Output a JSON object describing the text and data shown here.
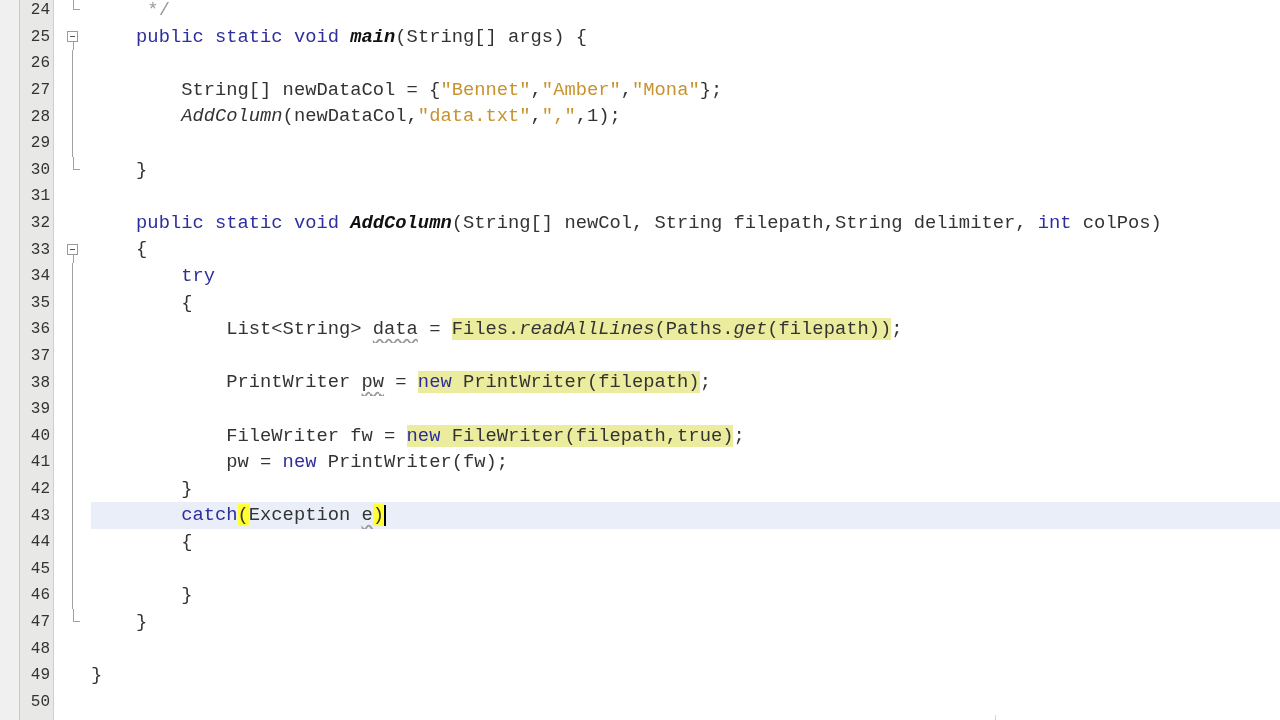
{
  "editor": {
    "lines": [
      {
        "number": "24",
        "kind": "end",
        "current": false,
        "tokens": [
          {
            "kind": "comment",
            "text": "     */"
          }
        ]
      },
      {
        "number": "25",
        "kind": "start",
        "current": false,
        "tokens": [
          {
            "kind": "keyword",
            "text": "    public static void "
          },
          {
            "kind": "method",
            "text": "main"
          },
          {
            "kind": "plain",
            "text": "(String[] args) {"
          }
        ]
      },
      {
        "number": "26",
        "kind": "mid",
        "current": false
      },
      {
        "number": "27",
        "kind": "mid",
        "current": false,
        "tokens": [
          {
            "kind": "plain",
            "text": "        String[] newDataCol = {"
          },
          {
            "kind": "string",
            "text": "\"Bennet\""
          },
          {
            "kind": "plain",
            "text": ","
          },
          {
            "kind": "string",
            "text": "\"Amber\""
          },
          {
            "kind": "plain",
            "text": ","
          },
          {
            "kind": "string",
            "text": "\"Mona\""
          },
          {
            "kind": "plain",
            "text": "};"
          }
        ]
      },
      {
        "number": "28",
        "kind": "mid",
        "current": false,
        "tokens": [
          {
            "kind": "call",
            "text": "        AddColumn"
          },
          {
            "kind": "plain",
            "text": "(newDataCol,"
          },
          {
            "kind": "string",
            "text": "\"data.txt\""
          },
          {
            "kind": "plain",
            "text": ","
          },
          {
            "kind": "string",
            "text": "\",\""
          },
          {
            "kind": "plain",
            "text": ",1);"
          }
        ]
      },
      {
        "number": "29",
        "kind": "mid",
        "current": false
      },
      {
        "number": "30",
        "kind": "end",
        "current": false,
        "tokens": [
          {
            "kind": "plain",
            "text": "    }"
          }
        ]
      },
      {
        "number": "31",
        "kind": "none",
        "current": false
      },
      {
        "number": "32",
        "kind": "none",
        "current": false,
        "tokens": [
          {
            "kind": "keyword",
            "text": "    public static void "
          },
          {
            "kind": "method",
            "text": "AddColumn"
          },
          {
            "kind": "plain",
            "text": "(String[] newCol, String filepath,String delimiter, "
          },
          {
            "kind": "keyword",
            "text": "int"
          },
          {
            "kind": "plain",
            "text": " colPos)"
          }
        ]
      },
      {
        "number": "33",
        "kind": "start",
        "current": false,
        "tokens": [
          {
            "kind": "plain",
            "text": "    {"
          }
        ]
      },
      {
        "number": "34",
        "kind": "mid",
        "current": false,
        "tokens": [
          {
            "kind": "keyword",
            "text": "        try"
          }
        ]
      },
      {
        "number": "35",
        "kind": "mid",
        "current": false,
        "tokens": [
          {
            "kind": "plain",
            "text": "        {"
          }
        ]
      },
      {
        "number": "36",
        "kind": "mid",
        "current": false,
        "tokens": [
          {
            "kind": "plain",
            "text": "            List<String> "
          },
          {
            "kind": "warning",
            "text": "data"
          },
          {
            "kind": "plain",
            "text": " = "
          },
          {
            "kind": "marked",
            "text": "Files."
          },
          {
            "kind": "call-marked",
            "text": "readAllLines"
          },
          {
            "kind": "marked",
            "text": "(Paths."
          },
          {
            "kind": "call-marked",
            "text": "get"
          },
          {
            "kind": "marked",
            "text": "(filepath))"
          },
          {
            "kind": "plain",
            "text": ";"
          }
        ]
      },
      {
        "number": "37",
        "kind": "mid",
        "current": false
      },
      {
        "number": "38",
        "kind": "mid",
        "current": false,
        "tokens": [
          {
            "kind": "plain",
            "text": "            PrintWriter "
          },
          {
            "kind": "warning",
            "text": "pw"
          },
          {
            "kind": "plain",
            "text": " = "
          },
          {
            "kind": "keyword-marked",
            "text": "new"
          },
          {
            "kind": "marked",
            "text": " PrintWriter(filepath)"
          },
          {
            "kind": "plain",
            "text": ";"
          }
        ]
      },
      {
        "number": "39",
        "kind": "mid",
        "current": false
      },
      {
        "number": "40",
        "kind": "mid",
        "current": false,
        "tokens": [
          {
            "kind": "plain",
            "text": "            FileWriter fw = "
          },
          {
            "kind": "keyword-marked",
            "text": "new"
          },
          {
            "kind": "marked",
            "text": " FileWriter(filepath,true)"
          },
          {
            "kind": "plain",
            "text": ";"
          }
        ]
      },
      {
        "number": "41",
        "kind": "mid",
        "current": false,
        "tokens": [
          {
            "kind": "plain",
            "text": "            pw = "
          },
          {
            "kind": "keyword",
            "text": "new"
          },
          {
            "kind": "plain",
            "text": " PrintWriter(fw);"
          }
        ]
      },
      {
        "number": "42",
        "kind": "mid",
        "current": false,
        "tokens": [
          {
            "kind": "plain",
            "text": "        }"
          }
        ]
      },
      {
        "number": "43",
        "kind": "mid",
        "current": true,
        "tokens": [
          {
            "kind": "keyword",
            "text": "        catch"
          },
          {
            "kind": "bracket",
            "text": "("
          },
          {
            "kind": "plain",
            "text": "Exception "
          },
          {
            "kind": "warning",
            "text": "e"
          },
          {
            "kind": "bracket",
            "text": ")"
          }
        ]
      },
      {
        "number": "44",
        "kind": "mid",
        "current": false,
        "tokens": [
          {
            "kind": "plain",
            "text": "        {"
          }
        ]
      },
      {
        "number": "45",
        "kind": "mid",
        "current": false
      },
      {
        "number": "46",
        "kind": "mid",
        "current": false,
        "tokens": [
          {
            "kind": "plain",
            "text": "        }"
          }
        ]
      },
      {
        "number": "47",
        "kind": "end",
        "current": false,
        "tokens": [
          {
            "kind": "plain",
            "text": "    }"
          }
        ]
      },
      {
        "number": "48",
        "kind": "none",
        "current": false
      },
      {
        "number": "49",
        "kind": "none",
        "current": false,
        "tokens": [
          {
            "kind": "plain",
            "text": "}"
          }
        ]
      },
      {
        "number": "50",
        "kind": "none",
        "current": false
      }
    ]
  }
}
